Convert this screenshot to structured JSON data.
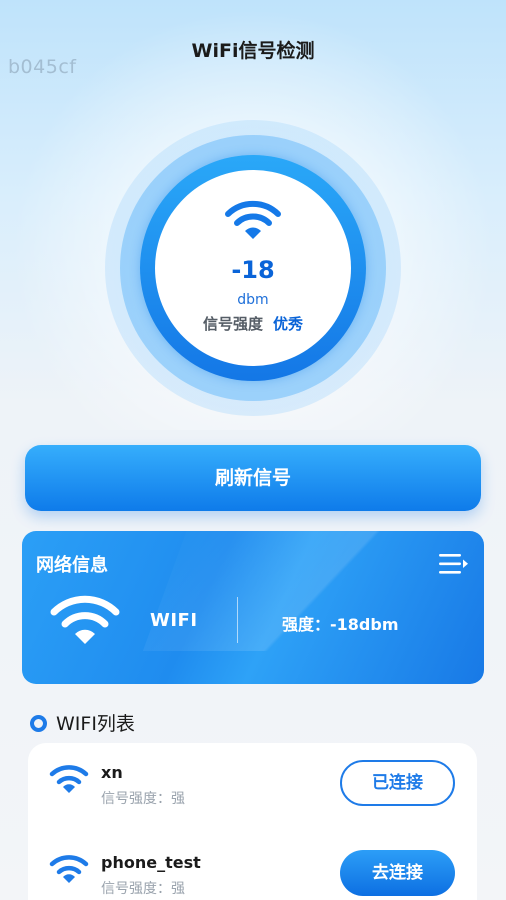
{
  "header": {
    "title": "WiFi信号检测",
    "watermark": "b045cf"
  },
  "gauge": {
    "value": "-18",
    "unit": "dbm",
    "strength_label": "信号强度",
    "quality": "优秀",
    "icon": "wifi-icon"
  },
  "refresh_button": {
    "label": "刷新信号"
  },
  "network_info": {
    "title": "网络信息",
    "menu_icon": "menu-list-icon",
    "name": "WIFI",
    "strength": "强度：-18dbm"
  },
  "wifi_list": {
    "title": "WIFI列表",
    "items": [
      {
        "name": "xn",
        "strength": "信号强度：强",
        "action": "已连接"
      },
      {
        "name": "phone_test",
        "strength": "信号强度：强",
        "action": "去连接"
      }
    ]
  },
  "colors": {
    "accent": "#1e7be8",
    "accent_light": "#36aefc",
    "text_dark": "#1b1b1b",
    "text_muted": "#9aa3ad"
  }
}
